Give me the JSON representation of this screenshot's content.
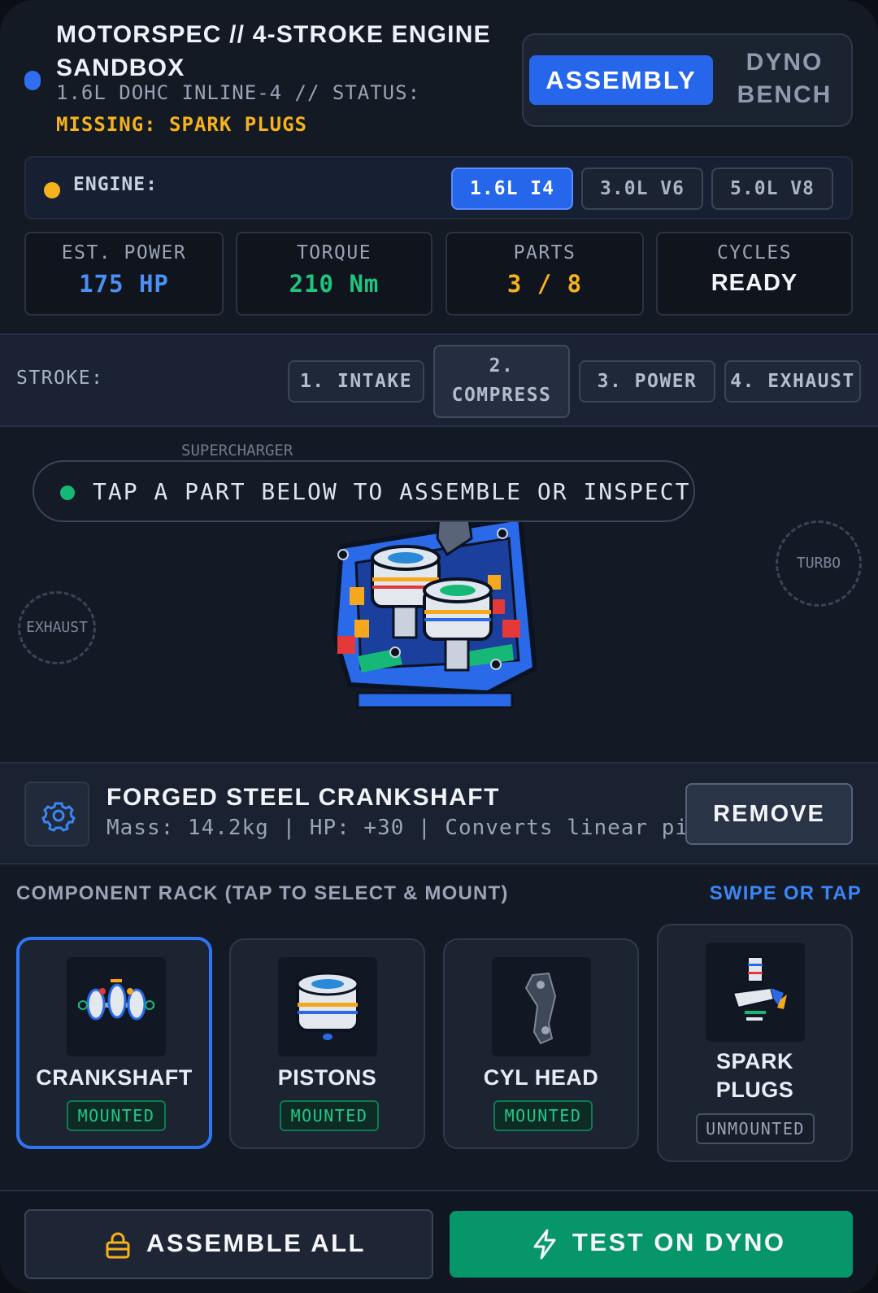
{
  "header": {
    "title": "MOTORSPEC // 4-STROKE ENGINE SANDBOX",
    "subtitle": "1.6L DOHC INLINE-4 // STATUS:",
    "missing": "MISSING: SPARK PLUGS",
    "modes": {
      "active": "ASSEMBLY",
      "inactive": "DYNO BENCH"
    }
  },
  "engine": {
    "label": "ENGINE:",
    "options": [
      "1.6L I4",
      "3.0L V6",
      "5.0L V8"
    ],
    "selected": "1.6L I4"
  },
  "stats": [
    {
      "label": "EST. POWER",
      "value": "175 HP",
      "color": "#4a90f5"
    },
    {
      "label": "TORQUE",
      "value": "210 Nm",
      "color": "#1fc47f"
    },
    {
      "label": "PARTS",
      "value": "3 / 8",
      "color": "#f5b21c"
    },
    {
      "label": "CYCLES",
      "value": "READY",
      "color": "#f2f4f8"
    }
  ],
  "stroke": {
    "label": "STROKE:",
    "steps": [
      "1. INTAKE",
      "2.",
      "COMPRESS",
      "3. POWER",
      "4. EXHAUST"
    ],
    "active_index": 1
  },
  "stage": {
    "hint": "TAP A PART BELOW TO ASSEMBLE OR INSPECT",
    "ghost_labels": {
      "supercharger": "SUPERCHARGER",
      "turbo": "TURBO",
      "exhaust": "EXHAUST"
    }
  },
  "selected_part": {
    "icon": "gear-icon",
    "name": "FORGED STEEL CRANKSHAFT",
    "description": "Mass: 14.2kg | HP: +30 | Converts linear pi",
    "remove_label": "REMOVE"
  },
  "rack": {
    "title": "COMPONENT RACK (TAP TO SELECT & MOUNT)",
    "link": "SWIPE OR TAP",
    "cards": [
      {
        "label": "CRANKSHAFT",
        "status": "MOUNTED"
      },
      {
        "label": "PISTONS",
        "status": "MOUNTED"
      },
      {
        "label": "CYL HEAD",
        "status": "MOUNTED"
      },
      {
        "label_line1": "SPARK",
        "label_line2": "PLUGS",
        "status": "UNMOUNTED"
      }
    ]
  },
  "footer": {
    "assemble_label": "ASSEMBLE ALL",
    "assemble_icon": "lock-icon",
    "dyno_label": "TEST ON DYNO",
    "dyno_icon": "lightning-icon"
  },
  "colors": {
    "accent_blue": "#2566ea",
    "accent_green": "#06966a",
    "warning_yellow": "#f5b21c"
  }
}
